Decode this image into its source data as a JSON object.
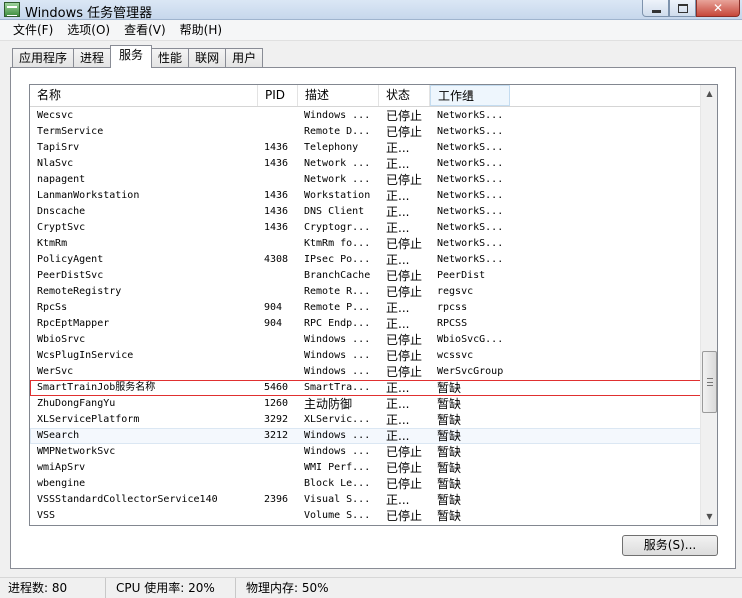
{
  "window": {
    "title": "Windows 任务管理器"
  },
  "menu": [
    "文件(F)",
    "选项(O)",
    "查看(V)",
    "帮助(H)"
  ],
  "tabs": [
    {
      "label": "应用程序",
      "active": false
    },
    {
      "label": "进程",
      "active": false
    },
    {
      "label": "服务",
      "active": true
    },
    {
      "label": "性能",
      "active": false
    },
    {
      "label": "联网",
      "active": false
    },
    {
      "label": "用户",
      "active": false
    }
  ],
  "columns": {
    "name": "名称",
    "pid": "PID",
    "desc": "描述",
    "status": "状态",
    "group": "工作组"
  },
  "rows": [
    {
      "name": "Wecsvc",
      "pid": "",
      "desc": "Windows ...",
      "status": "已停止",
      "group": "NetworkS..."
    },
    {
      "name": "TermService",
      "pid": "",
      "desc": "Remote D...",
      "status": "已停止",
      "group": "NetworkS..."
    },
    {
      "name": "TapiSrv",
      "pid": "1436",
      "desc": "Telephony",
      "status": "正...",
      "group": "NetworkS..."
    },
    {
      "name": "NlaSvc",
      "pid": "1436",
      "desc": "Network ...",
      "status": "正...",
      "group": "NetworkS..."
    },
    {
      "name": "napagent",
      "pid": "",
      "desc": "Network ...",
      "status": "已停止",
      "group": "NetworkS..."
    },
    {
      "name": "LanmanWorkstation",
      "pid": "1436",
      "desc": "Workstation",
      "status": "正...",
      "group": "NetworkS..."
    },
    {
      "name": "Dnscache",
      "pid": "1436",
      "desc": "DNS Client",
      "status": "正...",
      "group": "NetworkS..."
    },
    {
      "name": "CryptSvc",
      "pid": "1436",
      "desc": "Cryptogr...",
      "status": "正...",
      "group": "NetworkS..."
    },
    {
      "name": "KtmRm",
      "pid": "",
      "desc": "KtmRm fo...",
      "status": "已停止",
      "group": "NetworkS..."
    },
    {
      "name": "PolicyAgent",
      "pid": "4308",
      "desc": "IPsec Po...",
      "status": "正...",
      "group": "NetworkS..."
    },
    {
      "name": "PeerDistSvc",
      "pid": "",
      "desc": "BranchCache",
      "status": "已停止",
      "group": "PeerDist"
    },
    {
      "name": "RemoteRegistry",
      "pid": "",
      "desc": "Remote R...",
      "status": "已停止",
      "group": "regsvc"
    },
    {
      "name": "RpcSs",
      "pid": "904",
      "desc": "Remote P...",
      "status": "正...",
      "group": "rpcss"
    },
    {
      "name": "RpcEptMapper",
      "pid": "904",
      "desc": "RPC Endp...",
      "status": "正...",
      "group": "RPCSS"
    },
    {
      "name": "WbioSrvc",
      "pid": "",
      "desc": "Windows ...",
      "status": "已停止",
      "group": "WbioSvcG..."
    },
    {
      "name": "WcsPlugInService",
      "pid": "",
      "desc": "Windows ...",
      "status": "已停止",
      "group": "wcssvc"
    },
    {
      "name": "WerSvc",
      "pid": "",
      "desc": "Windows ...",
      "status": "已停止",
      "group": "WerSvcGroup"
    },
    {
      "name": "SmartTrainJob服务名称",
      "pid": "5460",
      "desc": "SmartTra...",
      "status": "正...",
      "group": "暂缺",
      "highlight": true
    },
    {
      "name": "ZhuDongFangYu",
      "pid": "1260",
      "desc": "主动防御",
      "status": "正...",
      "group": "暂缺"
    },
    {
      "name": "XLServicePlatform",
      "pid": "3292",
      "desc": "XLServic...",
      "status": "正...",
      "group": "暂缺"
    },
    {
      "name": "WSearch",
      "pid": "3212",
      "desc": "Windows ...",
      "status": "正...",
      "group": "暂缺",
      "selected": true
    },
    {
      "name": "WMPNetworkSvc",
      "pid": "",
      "desc": "Windows ...",
      "status": "已停止",
      "group": "暂缺"
    },
    {
      "name": "wmiApSrv",
      "pid": "",
      "desc": "WMI Perf...",
      "status": "已停止",
      "group": "暂缺"
    },
    {
      "name": "wbengine",
      "pid": "",
      "desc": "Block Le...",
      "status": "已停止",
      "group": "暂缺"
    },
    {
      "name": "VSSStandardCollectorService140",
      "pid": "2396",
      "desc": "Visual S...",
      "status": "正...",
      "group": "暂缺"
    },
    {
      "name": "VSS",
      "pid": "",
      "desc": "Volume S...",
      "status": "已停止",
      "group": "暂缺"
    }
  ],
  "services_button": "服务(S)...",
  "status_bar": {
    "processes": "进程数: 80",
    "cpu": "CPU 使用率: 20%",
    "memory": "物理内存: 50%"
  },
  "icons": {
    "app": "task-manager-icon",
    "scroll_up": "scroll-up-arrow-icon",
    "scroll_down": "scroll-down-arrow-icon"
  },
  "colors": {
    "highlight_border": "#e03030",
    "selected_row": "#f4f8fd"
  }
}
